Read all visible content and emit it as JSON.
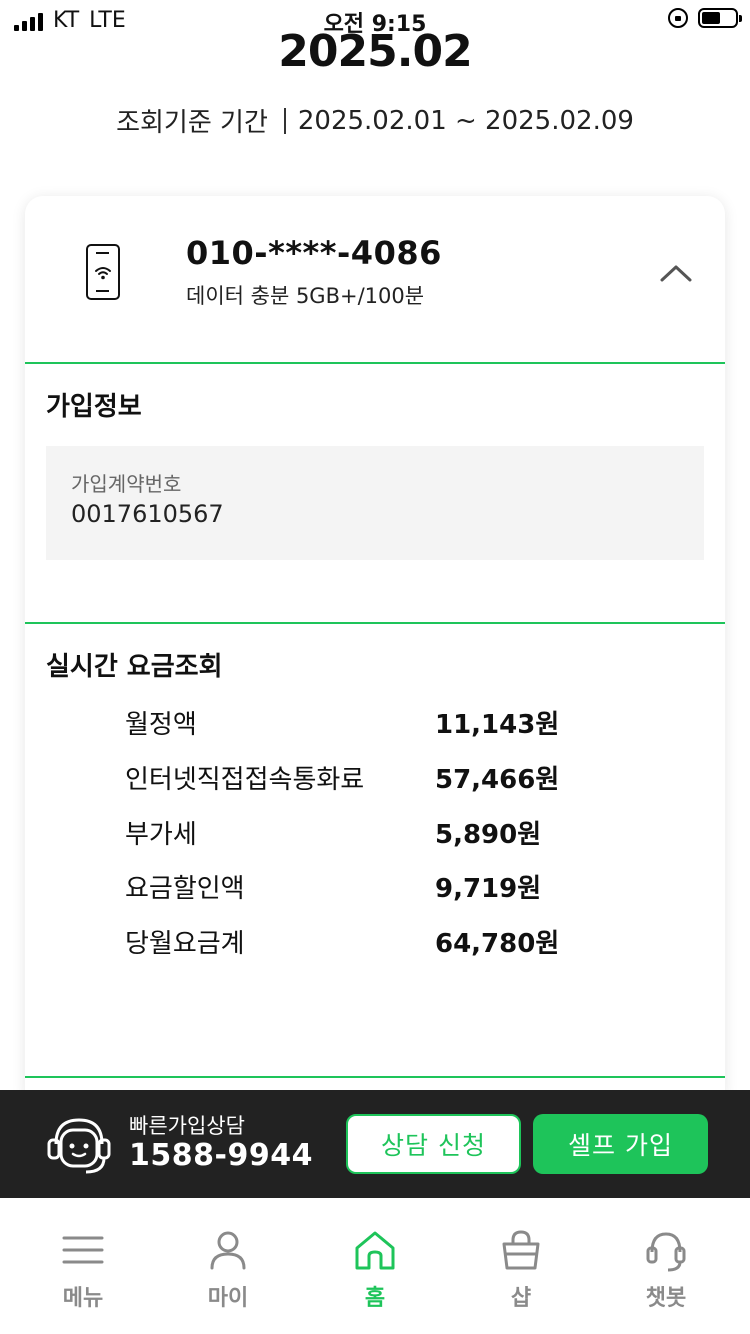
{
  "status_bar": {
    "carrier": "KT",
    "network": "LTE",
    "time": "오전 9:15"
  },
  "header": {
    "month": "2025.02",
    "period_label": "조회기준 기간",
    "period_range": "2025.02.01 ~ 2025.02.09"
  },
  "line_card": {
    "phone_number": "010-****-4086",
    "plan_name": "데이터 충분 5GB+/100분",
    "icon": "mobile-wifi-icon",
    "toggle_icon": "chevron-up-icon"
  },
  "subscription": {
    "title": "가입정보",
    "contract_label": "가입계약번호",
    "contract_number": "0017610567"
  },
  "billing": {
    "title": "실시간 요금조회",
    "rows": [
      {
        "label": "월정액",
        "amount": "11,143원"
      },
      {
        "label": "인터넷직접접속통화료",
        "amount": "57,466원"
      },
      {
        "label": "부가세",
        "amount": "5,890원"
      },
      {
        "label": "요금할인액",
        "amount": "9,719원"
      },
      {
        "label": "당월요금계",
        "amount": "64,780원"
      }
    ]
  },
  "cta": {
    "label": "빠른가입상담",
    "phone": "1588-9944",
    "consult_button": "상담 신청",
    "self_button": "셀프 가입",
    "icon": "headset-agent-icon"
  },
  "tab_bar": [
    {
      "label": "메뉴",
      "icon": "menu-icon",
      "active": false
    },
    {
      "label": "마이",
      "icon": "person-icon",
      "active": false
    },
    {
      "label": "홈",
      "icon": "home-icon",
      "active": true
    },
    {
      "label": "샵",
      "icon": "shopping-bag-icon",
      "active": false
    },
    {
      "label": "챗봇",
      "icon": "chatbot-headset-icon",
      "active": false
    }
  ],
  "colors": {
    "accent": "#1ec45a",
    "dark_bar": "#222222",
    "inactive_tab": "#8a8a8a"
  }
}
